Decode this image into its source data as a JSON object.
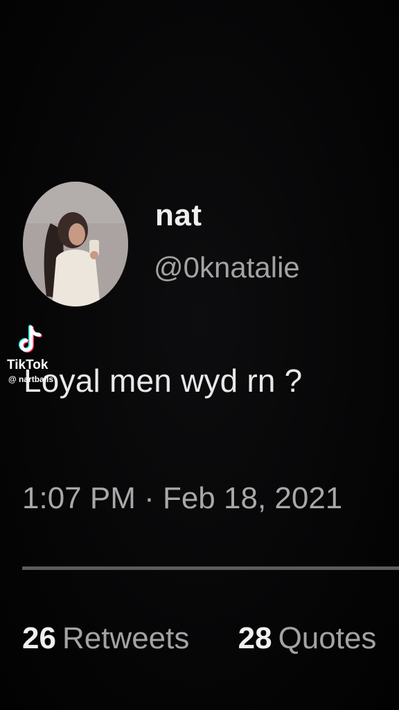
{
  "tweet": {
    "display_name": "nat",
    "handle": "@0knatalie",
    "text": "Loyal men wyd rn ?",
    "timestamp": "1:07 PM · Feb 18, 2021",
    "retweets_count": "26",
    "retweets_label": "Retweets",
    "quotes_count": "28",
    "quotes_label": "Quotes"
  },
  "watermark": {
    "brand": "TikTok",
    "username": "@ nartballs"
  },
  "colors": {
    "background": "#050505",
    "primary_text": "#e8e8e8",
    "secondary_text": "#a3a3a3",
    "divider": "#5c5c5c"
  },
  "icons": {
    "avatar": "profile-photo",
    "watermark": "tiktok-logo-icon"
  }
}
